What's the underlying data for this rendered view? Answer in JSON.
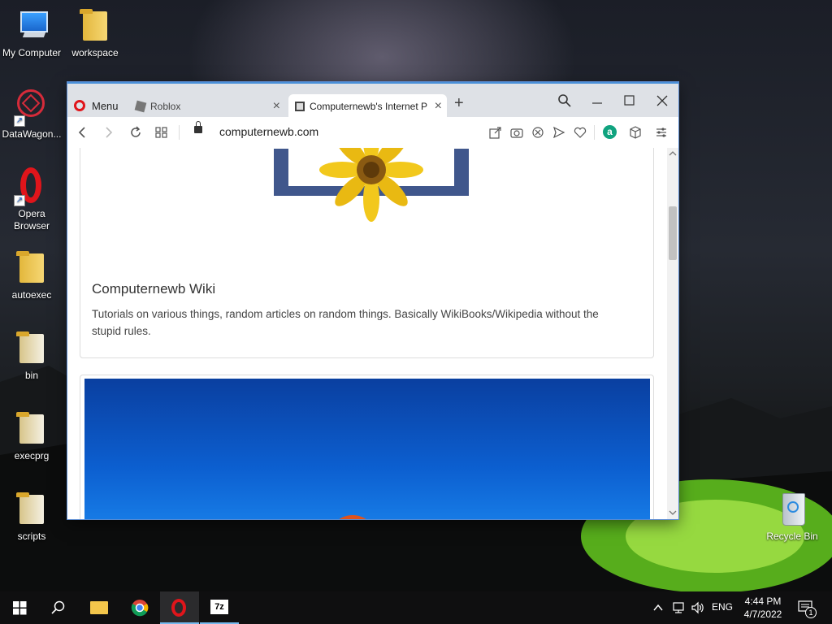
{
  "desktop": {
    "icons": [
      {
        "label": "My Computer"
      },
      {
        "label": "workspace"
      },
      {
        "label": "DataWagon..."
      },
      {
        "label": "Opera Browser"
      },
      {
        "label": "autoexec"
      },
      {
        "label": "bin"
      },
      {
        "label": "execprg"
      },
      {
        "label": "scripts"
      },
      {
        "label": "Recycle Bin"
      }
    ]
  },
  "browser": {
    "menu_label": "Menu",
    "tabs": [
      {
        "label": "Roblox"
      },
      {
        "label": "Computernewb's Internet P"
      }
    ],
    "url": "computernewb.com",
    "new_tab": "+",
    "extension_badge": "a"
  },
  "page": {
    "card_title": "Computernewb Wiki",
    "card_text": "Tutorials on various things, random articles on random things. Basically WikiBooks/Wikipedia without the stupid rules."
  },
  "taskbar": {
    "language": "ENG",
    "time": "4:44 PM",
    "date": "4/7/2022",
    "notification_count": "1"
  },
  "colors": {
    "opera_red": "#e0151b",
    "tab_bar": "#dee1e6",
    "accent": "#4a90d9"
  }
}
